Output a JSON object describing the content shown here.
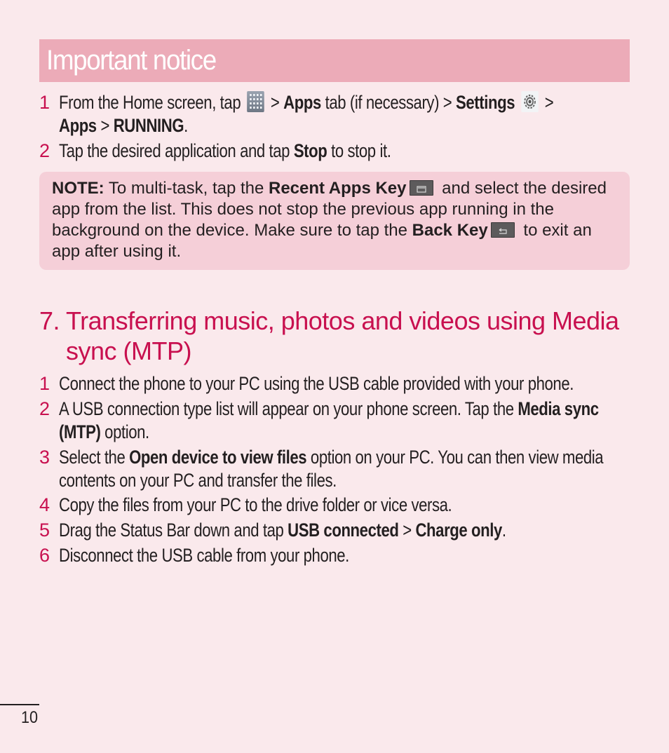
{
  "banner": {
    "title": "Important notice"
  },
  "steps_a": [
    {
      "num": "1",
      "line1_pre": "From the Home screen, tap",
      "icon1": "apps-grid-icon",
      "line1_sep1": " > ",
      "apps": "Apps",
      "line1_mid": " tab (if necessary) > ",
      "settings": "Settings",
      "icon2": "settings-gear-icon",
      "line1_end": " >",
      "line2_apps": "Apps",
      "line2_sep": " > ",
      "line2_running": "RUNNING",
      "line2_end": "."
    },
    {
      "num": "2",
      "pre": "Tap the desired application and tap ",
      "bold": "Stop",
      "post": " to stop it."
    }
  ],
  "note": {
    "label": "NOTE:",
    "t1": " To multi-task, tap the ",
    "recent_key": "Recent Apps Key",
    "recent_icon": "recent-apps-key-icon",
    "t2": " and select the desired app from the list. This does not stop the previous app running in the background on the device. Make sure to tap the ",
    "back_key": "Back Key",
    "back_icon": "back-key-icon",
    "t3": " to exit an app after using it."
  },
  "section": {
    "number": "7.",
    "title_line1": "Transferring music, photos and videos using Media",
    "title_line2": "sync (MTP)"
  },
  "steps_b": [
    {
      "num": "1",
      "lines": [
        {
          "parts": [
            {
              "t": "Connect the phone to your PC using the USB cable provided with your phone.",
              "b": false
            }
          ]
        }
      ]
    },
    {
      "num": "2",
      "lines": [
        {
          "parts": [
            {
              "t": "A USB connection type list will appear on your phone screen. Tap the ",
              "b": false
            },
            {
              "t": "Media sync",
              "b": true
            }
          ]
        },
        {
          "parts": [
            {
              "t": "(MTP)",
              "b": true
            },
            {
              "t": " option.",
              "b": false
            }
          ]
        }
      ]
    },
    {
      "num": "3",
      "lines": [
        {
          "parts": [
            {
              "t": "Select the ",
              "b": false
            },
            {
              "t": "Open device to view files",
              "b": true
            },
            {
              "t": " option on your PC. You can then view media",
              "b": false
            }
          ]
        },
        {
          "parts": [
            {
              "t": "contents on your PC and transfer the files.",
              "b": false
            }
          ]
        }
      ]
    },
    {
      "num": "4",
      "lines": [
        {
          "parts": [
            {
              "t": "Copy the files from your PC to the drive folder or vice versa.",
              "b": false
            }
          ]
        }
      ]
    },
    {
      "num": "5",
      "lines": [
        {
          "parts": [
            {
              "t": "Drag the Status Bar down and tap ",
              "b": false
            },
            {
              "t": "USB connected",
              "b": true
            },
            {
              "t": " > ",
              "b": false
            },
            {
              "t": "Charge only",
              "b": true
            },
            {
              "t": ".",
              "b": false
            }
          ]
        }
      ]
    },
    {
      "num": "6",
      "lines": [
        {
          "parts": [
            {
              "t": "Disconnect the USB cable from your phone.",
              "b": false
            }
          ]
        }
      ]
    }
  ],
  "footer": {
    "page_number": "10"
  },
  "colors": {
    "accent": "#c8104f",
    "banner": "#ecabb8",
    "note_bg": "#f5cfd8",
    "page_bg": "#fae9ec"
  }
}
